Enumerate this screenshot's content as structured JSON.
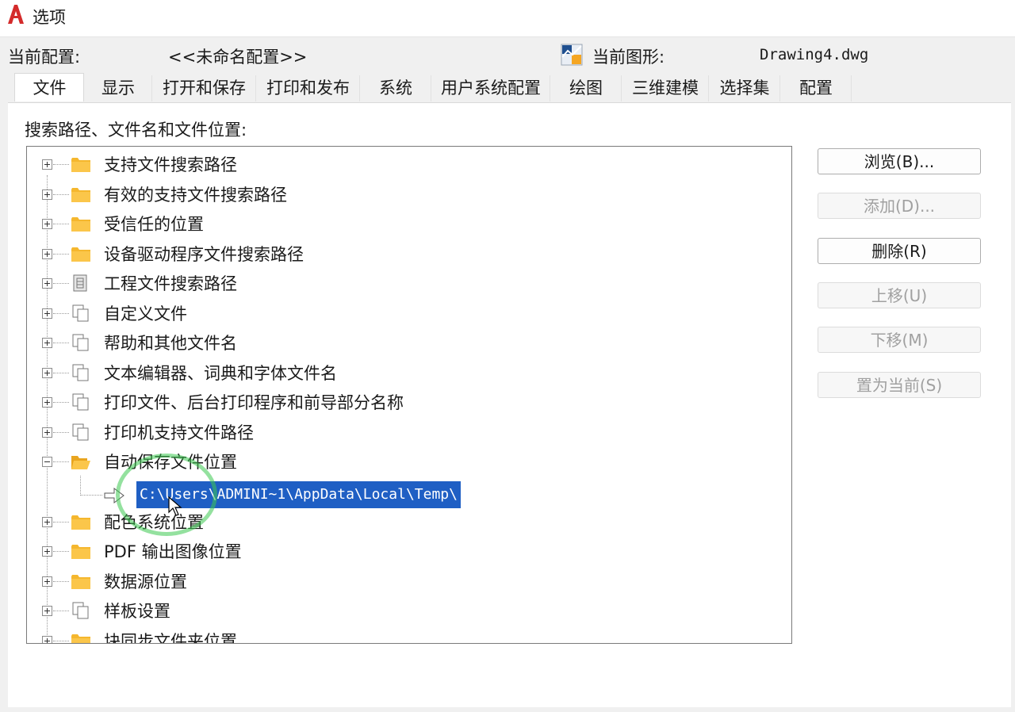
{
  "window": {
    "title": "选项"
  },
  "header": {
    "current_profile_label": "当前配置:",
    "current_profile_value": "<<未命名配置>>",
    "current_drawing_label": "当前图形:",
    "current_drawing_value": "Drawing4.dwg"
  },
  "tabs": [
    {
      "label": "文件",
      "active": true
    },
    {
      "label": "显示"
    },
    {
      "label": "打开和保存"
    },
    {
      "label": "打印和发布"
    },
    {
      "label": "系统"
    },
    {
      "label": "用户系统配置"
    },
    {
      "label": "绘图"
    },
    {
      "label": "三维建模"
    },
    {
      "label": "选择集"
    },
    {
      "label": "配置"
    }
  ],
  "section": {
    "label": "搜索路径、文件名和文件位置:"
  },
  "tree": {
    "items": [
      {
        "label": "支持文件搜索路径",
        "icon": "folder-icon"
      },
      {
        "label": "有效的支持文件搜索路径",
        "icon": "folder-icon"
      },
      {
        "label": "受信任的位置",
        "icon": "folder-icon"
      },
      {
        "label": "设备驱动程序文件搜索路径",
        "icon": "folder-icon"
      },
      {
        "label": "工程文件搜索路径",
        "icon": "project-icon"
      },
      {
        "label": "自定义文件",
        "icon": "files-icon"
      },
      {
        "label": "帮助和其他文件名",
        "icon": "files-icon"
      },
      {
        "label": "文本编辑器、词典和字体文件名",
        "icon": "files-icon"
      },
      {
        "label": "打印文件、后台打印程序和前导部分名称",
        "icon": "files-icon"
      },
      {
        "label": "打印机支持文件路径",
        "icon": "files-icon"
      },
      {
        "label": "自动保存文件位置",
        "icon": "open-folder-icon",
        "expanded": true
      },
      {
        "label": "配色系统位置",
        "icon": "folder-icon"
      },
      {
        "label": "PDF 输出图像位置",
        "icon": "folder-icon"
      },
      {
        "label": "数据源位置",
        "icon": "folder-icon"
      },
      {
        "label": "样板设置",
        "icon": "files-icon"
      },
      {
        "label": "块同步文件夹位置",
        "icon": "folder-icon"
      }
    ],
    "selected_path": "C:\\Users\\ADMINI~1\\AppData\\Local\\Temp\\"
  },
  "buttons": {
    "browse": "浏览(B)...",
    "add": "添加(D)...",
    "remove": "删除(R)",
    "move_up": "上移(U)",
    "move_down": "下移(M)",
    "set_current": "置为当前(S)"
  },
  "colors": {
    "accent": "#1f5fc4",
    "folder": "#f5b72e",
    "logo": "#d42b2b",
    "annotation": "#3cc850"
  }
}
